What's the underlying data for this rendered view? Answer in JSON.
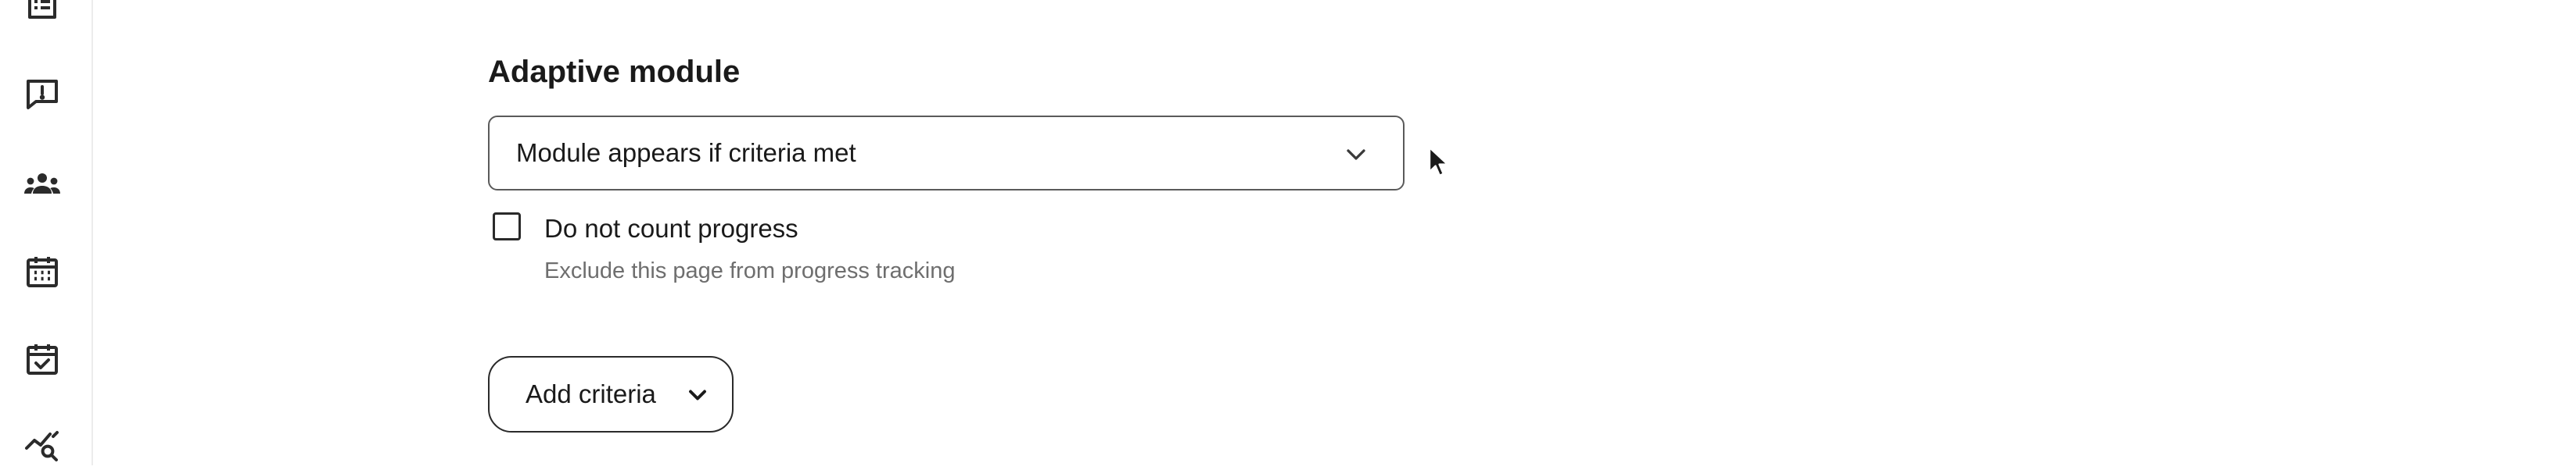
{
  "sidebar": {
    "icons": [
      {
        "name": "list-icon"
      },
      {
        "name": "feedback-icon"
      },
      {
        "name": "groups-icon"
      },
      {
        "name": "calendar-icon"
      },
      {
        "name": "calendar-check-icon"
      },
      {
        "name": "analytics-search-icon"
      }
    ]
  },
  "adaptive": {
    "title": "Adaptive module",
    "select_value": "Module appears if criteria met",
    "checkbox_label": "Do not count progress",
    "checkbox_checked": false,
    "checkbox_help": "Exclude this page from progress tracking",
    "add_criteria_label": "Add criteria"
  },
  "colors": {
    "text": "#1a1a1a",
    "muted": "#6e6e6e",
    "border": "#5a5a5a"
  }
}
